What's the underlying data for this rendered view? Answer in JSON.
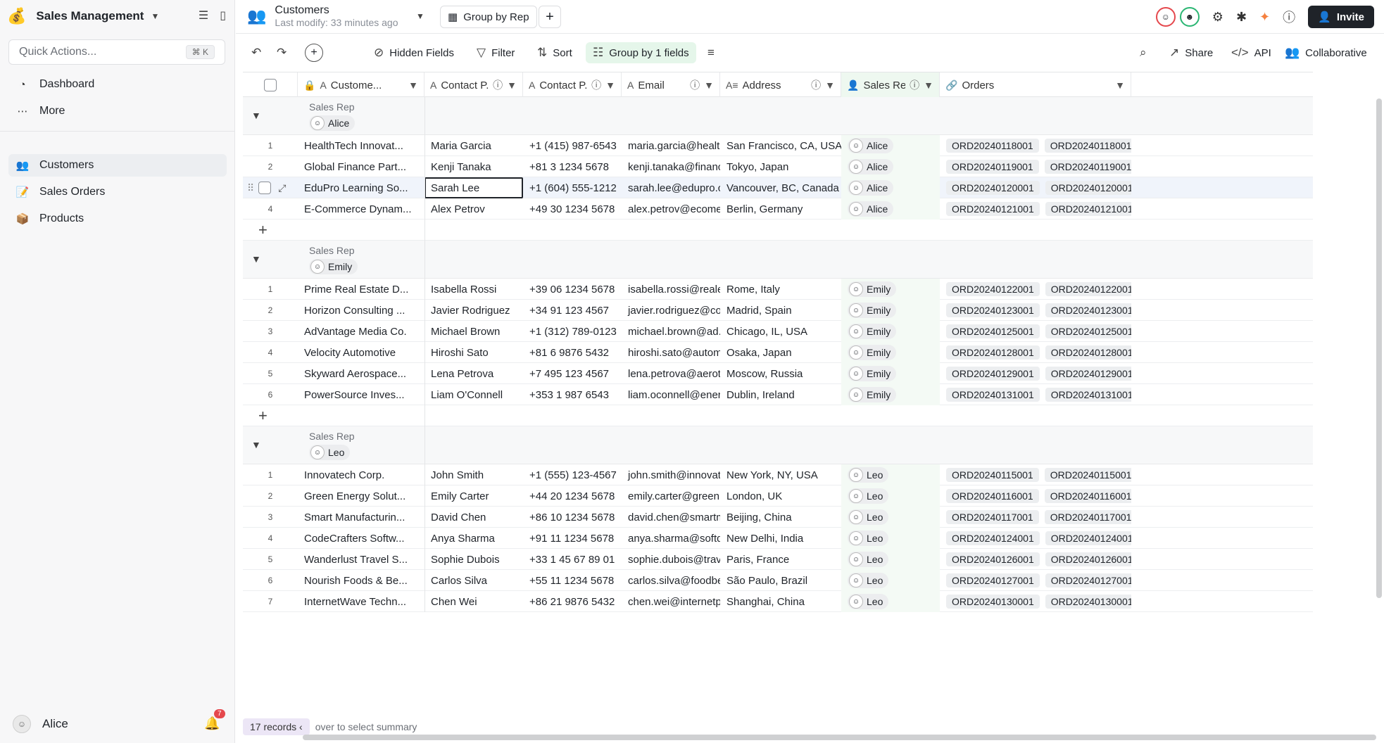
{
  "sidebar": {
    "app_title": "Sales Management",
    "quick_actions": {
      "placeholder": "Quick Actions...",
      "shortcut": "⌘ K"
    },
    "top_items": [
      {
        "label": "Dashboard"
      },
      {
        "label": "More"
      }
    ],
    "tables": [
      {
        "label": "Customers"
      },
      {
        "label": "Sales Orders"
      },
      {
        "label": "Products"
      }
    ],
    "user": "Alice",
    "notifications": "7"
  },
  "topbar": {
    "table_name": "Customers",
    "last_modified": "Last modify: 33 minutes ago",
    "view_name": "Group by Rep",
    "invite_label": "Invite"
  },
  "toolbar": {
    "hidden_fields": "Hidden Fields",
    "filter": "Filter",
    "sort": "Sort",
    "group": "Group by 1 fields",
    "share": "Share",
    "api": "API",
    "collaborative": "Collaborative"
  },
  "columns": [
    "Custome...",
    "Contact P...",
    "Contact P...",
    "Email",
    "Address",
    "Sales Rep",
    "Orders"
  ],
  "group_label": "Sales Rep",
  "groups": [
    {
      "rep": "Alice",
      "rows": [
        {
          "n": "1",
          "c": "HealthTech Innovat...",
          "p": "Maria Garcia",
          "ph": "+1 (415) 987-6543",
          "e": "maria.garcia@health...",
          "a": "San Francisco, CA, USA",
          "r": "Alice",
          "o": "ORD20240118001"
        },
        {
          "n": "2",
          "c": "Global Finance Part...",
          "p": "Kenji Tanaka",
          "ph": "+81 3 1234 5678",
          "e": "kenji.tanaka@financ...",
          "a": "Tokyo, Japan",
          "r": "Alice",
          "o": "ORD20240119001"
        },
        {
          "n": "",
          "c": "EduPro Learning So...",
          "p": "Sarah Lee",
          "ph": "+1 (604) 555-1212",
          "e": "sarah.lee@edupro.ca",
          "a": "Vancouver, BC, Canada",
          "r": "Alice",
          "o": "ORD20240120001"
        },
        {
          "n": "4",
          "c": "E-Commerce Dynam...",
          "p": "Alex Petrov",
          "ph": "+49 30 1234 5678",
          "e": "alex.petrov@ecome...",
          "a": "Berlin, Germany",
          "r": "Alice",
          "o": "ORD20240121001"
        }
      ]
    },
    {
      "rep": "Emily",
      "rows": [
        {
          "n": "1",
          "c": "Prime Real Estate D...",
          "p": "Isabella Rossi",
          "ph": "+39 06 1234 5678",
          "e": "isabella.rossi@reale...",
          "a": "Rome, Italy",
          "r": "Emily",
          "o": "ORD20240122001"
        },
        {
          "n": "2",
          "c": "Horizon Consulting ...",
          "p": "Javier Rodriguez",
          "ph": "+34 91 123 4567",
          "e": "javier.rodriguez@co...",
          "a": "Madrid, Spain",
          "r": "Emily",
          "o": "ORD20240123001"
        },
        {
          "n": "3",
          "c": "AdVantage Media Co.",
          "p": "Michael Brown",
          "ph": "+1 (312) 789-0123",
          "e": "michael.brown@ad...",
          "a": "Chicago, IL, USA",
          "r": "Emily",
          "o": "ORD20240125001"
        },
        {
          "n": "4",
          "c": "Velocity Automotive",
          "p": "Hiroshi Sato",
          "ph": "+81 6 9876 5432",
          "e": "hiroshi.sato@autom...",
          "a": "Osaka, Japan",
          "r": "Emily",
          "o": "ORD20240128001"
        },
        {
          "n": "5",
          "c": "Skyward Aerospace...",
          "p": "Lena Petrova",
          "ph": "+7 495 123 4567",
          "e": "lena.petrova@aerot...",
          "a": "Moscow, Russia",
          "r": "Emily",
          "o": "ORD20240129001"
        },
        {
          "n": "6",
          "c": "PowerSource Inves...",
          "p": "Liam O'Connell",
          "ph": "+353 1 987 6543",
          "e": "liam.oconnell@ener...",
          "a": "Dublin, Ireland",
          "r": "Emily",
          "o": "ORD20240131001"
        }
      ]
    },
    {
      "rep": "Leo",
      "rows": [
        {
          "n": "1",
          "c": "Innovatech Corp.",
          "p": "John Smith",
          "ph": "+1 (555) 123-4567",
          "e": "john.smith@innovat...",
          "a": "New York, NY, USA",
          "r": "Leo",
          "o": "ORD20240115001"
        },
        {
          "n": "2",
          "c": "Green Energy Solut...",
          "p": "Emily Carter",
          "ph": "+44 20 1234 5678",
          "e": "emily.carter@green...",
          "a": "London, UK",
          "r": "Leo",
          "o": "ORD20240116001"
        },
        {
          "n": "3",
          "c": "Smart Manufacturin...",
          "p": "David Chen",
          "ph": "+86 10 1234 5678",
          "e": "david.chen@smartm...",
          "a": "Beijing, China",
          "r": "Leo",
          "o": "ORD20240117001"
        },
        {
          "n": "4",
          "c": "CodeCrafters Softw...",
          "p": "Anya Sharma",
          "ph": "+91 11 1234 5678",
          "e": "anya.sharma@softd...",
          "a": "New Delhi, India",
          "r": "Leo",
          "o": "ORD20240124001"
        },
        {
          "n": "5",
          "c": "Wanderlust Travel S...",
          "p": "Sophie Dubois",
          "ph": "+33 1 45 67 89 01",
          "e": "sophie.dubois@trav...",
          "a": "Paris, France",
          "r": "Leo",
          "o": "ORD20240126001"
        },
        {
          "n": "6",
          "c": "Nourish Foods & Be...",
          "p": "Carlos Silva",
          "ph": "+55 11 1234 5678",
          "e": "carlos.silva@foodbe...",
          "a": "São Paulo, Brazil",
          "r": "Leo",
          "o": "ORD20240127001"
        },
        {
          "n": "7",
          "c": "InternetWave Techn...",
          "p": "Chen Wei",
          "ph": "+86 21 9876 5432",
          "e": "chen.wei@internetp...",
          "a": "Shanghai, China",
          "r": "Leo",
          "o": "ORD20240130001"
        }
      ]
    }
  ],
  "footer": {
    "records": "17 records",
    "hint": "over to select summary"
  }
}
